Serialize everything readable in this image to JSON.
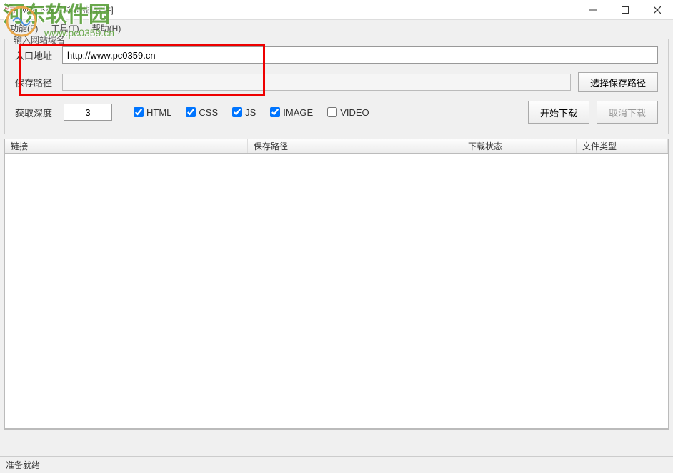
{
  "titlebar": {
    "title": "网站下载工具-[明振软件]"
  },
  "menubar": {
    "items": [
      {
        "label": "功能(F)"
      },
      {
        "label": "工具(T)"
      },
      {
        "label": "帮助(H)"
      }
    ]
  },
  "fieldset": {
    "legend": "输入网站域名",
    "entry_label": "入口地址",
    "entry_value": "http://www.pc0359.cn",
    "save_label": "保存路径",
    "save_value": "",
    "browse_btn": "选择保存路径",
    "depth_label": "获取深度",
    "depth_value": "3",
    "checkboxes": [
      {
        "label": "HTML",
        "checked": true
      },
      {
        "label": "CSS",
        "checked": true
      },
      {
        "label": "JS",
        "checked": true
      },
      {
        "label": "IMAGE",
        "checked": true
      },
      {
        "label": "VIDEO",
        "checked": false
      }
    ],
    "start_btn": "开始下载",
    "cancel_btn": "取消下载"
  },
  "table": {
    "headers": [
      "链接",
      "保存路径",
      "下载状态",
      "文件类型"
    ]
  },
  "statusbar": {
    "text": "准备就绪"
  },
  "watermark": {
    "text": "河东软件园",
    "url": "www.pc0359.cn"
  }
}
